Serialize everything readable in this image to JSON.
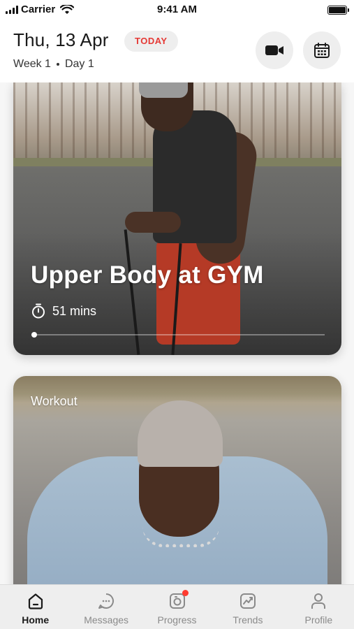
{
  "status_bar": {
    "carrier": "Carrier",
    "time": "9:41 AM"
  },
  "header": {
    "date": "Thu, 13 Apr",
    "today_badge": "TODAY",
    "week": "Week 1",
    "day": "Day 1",
    "actions": [
      "video-camera-icon",
      "calendar-icon"
    ]
  },
  "cards": [
    {
      "title": "Upper Body at GYM",
      "duration": "51 mins",
      "progress_fraction": 0.0
    },
    {
      "label": "Workout"
    }
  ],
  "tab_bar": {
    "items": [
      {
        "label": "Home",
        "icon": "home-icon",
        "active": true
      },
      {
        "label": "Messages",
        "icon": "chat-icon",
        "active": false
      },
      {
        "label": "Progress",
        "icon": "camera-icon",
        "active": false,
        "has_notification": true
      },
      {
        "label": "Trends",
        "icon": "trend-chart-icon",
        "active": false
      },
      {
        "label": "Profile",
        "icon": "person-icon",
        "active": false
      }
    ]
  },
  "colors": {
    "accent_red": "#e53935",
    "notification_dot": "#ff3b30",
    "active_tab_text": "#1a1a1a",
    "inactive_tab_text": "#8a8a8a"
  }
}
